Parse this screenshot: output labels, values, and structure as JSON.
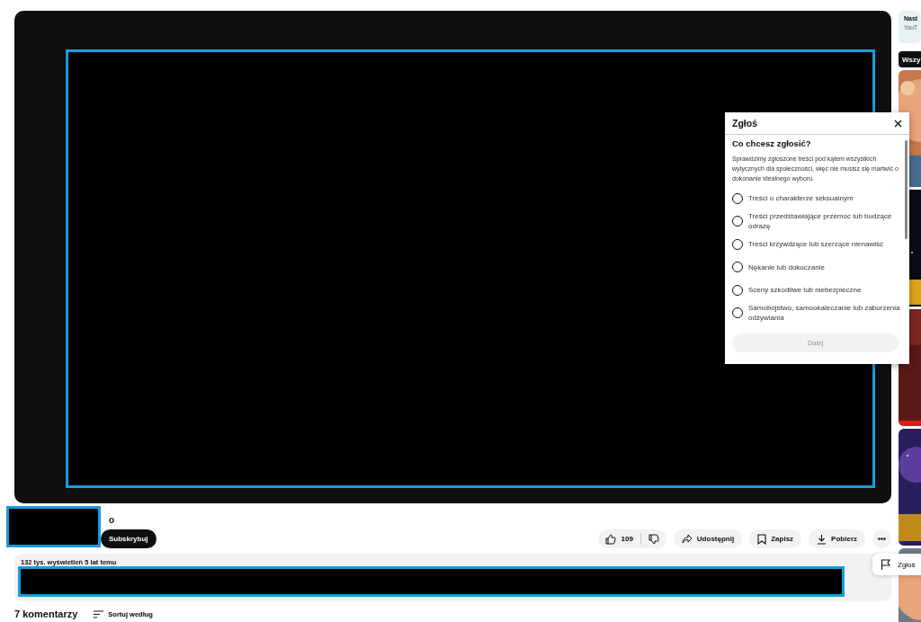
{
  "sidebar": {
    "next_card": {
      "title": "Nast",
      "subtitle": "YouT"
    },
    "chip": {
      "label": "Wszy",
      "selected": true
    }
  },
  "channel": {
    "name_fragment": "o",
    "subscribe_label": "Subskrybuj"
  },
  "actions": {
    "likes": "109",
    "buttons": [
      {
        "kind": "share",
        "label": "Udostępnij"
      },
      {
        "kind": "save",
        "label": "Zapisz"
      },
      {
        "kind": "download",
        "label": "Pobierz"
      }
    ]
  },
  "description": {
    "meta": "132 tys. wyświetleń  5 lat temu"
  },
  "comments": {
    "count": "7 komentarzy",
    "sort_label": "Sortuj według"
  },
  "menu_popup": {
    "items": [
      {
        "kind": "report",
        "label": "Zgłoś"
      }
    ]
  },
  "report_dialog": {
    "title": "Zgłoś",
    "question": "Co chcesz zgłosić?",
    "intro": "Sprawdzimy zgłoszone treści pod kątem wszystkich wytycznych dla społeczności, więc nie musisz się martwić o dokonanie idealnego wyboru.",
    "options": [
      {
        "label": "Treści o charakterze seksualnym",
        "selected": false
      },
      {
        "label": "Treści przedstawiające przemoc lub budzące odrazę",
        "selected": false
      },
      {
        "label": "Treści krzywdzące lub szerzące nienawiść",
        "selected": false
      },
      {
        "label": "Nękanie lub dokuczanie",
        "selected": false
      },
      {
        "label": "Sceny szkodliwe lub niebezpieczne",
        "selected": false
      },
      {
        "label": "Samobójstwo, samookaleczanie lub zaburzenia odżywiania",
        "selected": false
      }
    ],
    "next_button": {
      "label": "Dalej",
      "disabled": true
    }
  }
}
